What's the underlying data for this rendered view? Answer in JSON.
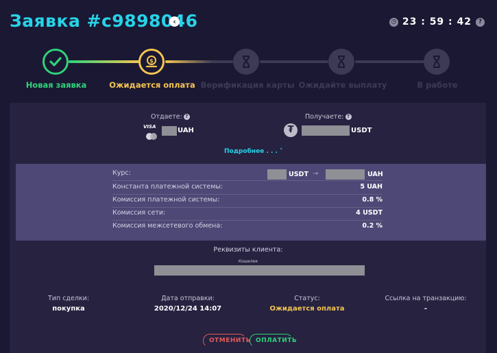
{
  "header": {
    "title": "Заявка #c9898046",
    "timer": "23 : 59 : 42"
  },
  "steps": [
    {
      "label": "Новая заявка",
      "state": "done"
    },
    {
      "label": "Ожидается оплата",
      "state": "current"
    },
    {
      "label": "Верификация карты",
      "state": "pending"
    },
    {
      "label": "Ожидайте выплату",
      "state": "pending"
    },
    {
      "label": "В работе",
      "state": "pending"
    }
  ],
  "exchange": {
    "give_label": "Отдаете:",
    "give_currency": "UAH",
    "give_card_brand": "VISA",
    "receive_label": "Получаете:",
    "receive_currency": "USDT",
    "more_link": "Подробнее . . ."
  },
  "details": [
    {
      "label": "Курс:",
      "value": ""
    },
    {
      "label": "Константа платежной системы:",
      "value": "5 UAH"
    },
    {
      "label": "Комиссия платежной системы:",
      "value": "0.8 %"
    },
    {
      "label": "Комиссия сети:",
      "value": "4 USDT"
    },
    {
      "label": "Комиссия межсетевого обмена:",
      "value": "0.2 %"
    }
  ],
  "rate": {
    "from": "USDT",
    "to": "UAH"
  },
  "client": {
    "title": "Реквизиты клиента:",
    "wallet_label": "Кошелек"
  },
  "info": [
    {
      "label": "Тип сделки:",
      "value": "покупка"
    },
    {
      "label": "Дата отправки:",
      "value": "2020/12/24 14:07"
    },
    {
      "label": "Статус:",
      "value": "Ожидается оплата"
    },
    {
      "label": "Ссылка на транзакцию:",
      "value": "-"
    }
  ],
  "buttons": {
    "cancel": "ОТМЕНИТЬ",
    "pay": "ОПЛАТИТЬ"
  },
  "colors": {
    "accent": "#27d3e7",
    "done": "#2ed47a",
    "current": "#f5c651",
    "pending": "#3d3a55",
    "cancel": "#e25a5a"
  }
}
